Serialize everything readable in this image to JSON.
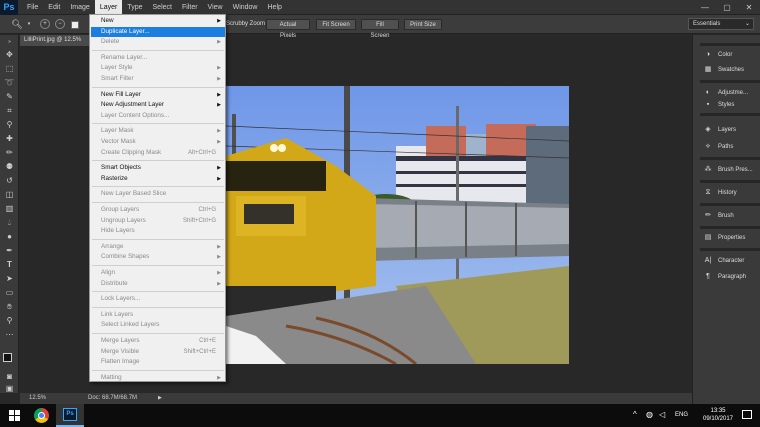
{
  "app": {
    "logo": "Ps"
  },
  "menubar": {
    "items": [
      "File",
      "Edit",
      "Image",
      "Layer",
      "Type",
      "Select",
      "Filter",
      "View",
      "Window",
      "Help"
    ],
    "active": "Layer"
  },
  "window_controls": {
    "minimize": "—",
    "maximize": "▢",
    "close": "✕"
  },
  "options_bar": {
    "scrubby_zoom": "Scrubby Zoom",
    "buttons": [
      "Actual Pixels",
      "Fit Screen",
      "Fill Screen",
      "Print Size"
    ],
    "workspace": "Essentials"
  },
  "document": {
    "tab_title": "LilliPrint.jpg @ 12.5%",
    "zoom": "12.5%",
    "doc_size": "Doc: 68.7M/68.7M"
  },
  "layer_menu": {
    "items": [
      {
        "label": "New",
        "submenu": true,
        "disabled": false
      },
      {
        "label": "Duplicate Layer...",
        "highlighted": true,
        "disabled": false
      },
      {
        "label": "Delete",
        "submenu": true,
        "disabled": true
      },
      {
        "sep": true
      },
      {
        "label": "Rename Layer...",
        "disabled": true
      },
      {
        "label": "Layer Style",
        "submenu": true,
        "disabled": true
      },
      {
        "label": "Smart Filter",
        "submenu": true,
        "disabled": true
      },
      {
        "sep": true
      },
      {
        "label": "New Fill Layer",
        "submenu": true,
        "disabled": false
      },
      {
        "label": "New Adjustment Layer",
        "submenu": true,
        "disabled": false
      },
      {
        "label": "Layer Content Options...",
        "disabled": true
      },
      {
        "sep": true
      },
      {
        "label": "Layer Mask",
        "submenu": true,
        "disabled": true
      },
      {
        "label": "Vector Mask",
        "submenu": true,
        "disabled": true
      },
      {
        "label": "Create Clipping Mask",
        "shortcut": "Alt+Ctrl+G",
        "disabled": true
      },
      {
        "sep": true
      },
      {
        "label": "Smart Objects",
        "submenu": true,
        "disabled": false
      },
      {
        "label": "Rasterize",
        "submenu": true,
        "disabled": false
      },
      {
        "sep": true
      },
      {
        "label": "New Layer Based Slice",
        "disabled": true
      },
      {
        "sep": true
      },
      {
        "label": "Group Layers",
        "shortcut": "Ctrl+G",
        "disabled": true
      },
      {
        "label": "Ungroup Layers",
        "shortcut": "Shift+Ctrl+G",
        "disabled": true
      },
      {
        "label": "Hide Layers",
        "disabled": true
      },
      {
        "sep": true
      },
      {
        "label": "Arrange",
        "submenu": true,
        "disabled": true
      },
      {
        "label": "Combine Shapes",
        "submenu": true,
        "disabled": true
      },
      {
        "sep": true
      },
      {
        "label": "Align",
        "submenu": true,
        "disabled": true
      },
      {
        "label": "Distribute",
        "submenu": true,
        "disabled": true
      },
      {
        "sep": true
      },
      {
        "label": "Lock Layers...",
        "disabled": true
      },
      {
        "sep": true
      },
      {
        "label": "Link Layers",
        "disabled": true
      },
      {
        "label": "Select Linked Layers",
        "disabled": true
      },
      {
        "sep": true
      },
      {
        "label": "Merge Layers",
        "shortcut": "Ctrl+E",
        "disabled": true
      },
      {
        "label": "Merge Visible",
        "shortcut": "Shift+Ctrl+E",
        "disabled": true
      },
      {
        "label": "Flatten Image",
        "disabled": true
      },
      {
        "sep": true
      },
      {
        "label": "Matting",
        "submenu": true,
        "disabled": true
      }
    ]
  },
  "panels": {
    "items": [
      {
        "label": "Color",
        "icon": "color-icon"
      },
      {
        "label": "Swatches",
        "icon": "swatches-icon"
      },
      {
        "label": "Adjustme...",
        "icon": "adjustments-icon"
      },
      {
        "label": "Styles",
        "icon": "styles-icon"
      },
      {
        "label": "Layers",
        "icon": "layers-icon"
      },
      {
        "label": "Paths",
        "icon": "paths-icon"
      },
      {
        "label": "Brush Pres...",
        "icon": "brush-presets-icon"
      },
      {
        "label": "History",
        "icon": "history-icon"
      },
      {
        "label": "Brush",
        "icon": "brush-icon"
      },
      {
        "label": "Properties",
        "icon": "properties-icon"
      },
      {
        "label": "Character",
        "icon": "character-icon"
      },
      {
        "label": "Paragraph",
        "icon": "paragraph-icon"
      }
    ]
  },
  "taskbar": {
    "language": "ENG",
    "time": "13:35",
    "date": "09/10/2017"
  },
  "colors": {
    "highlight": "#1c7ede",
    "menubar": "#333333",
    "canvas_bg": "#282828"
  }
}
